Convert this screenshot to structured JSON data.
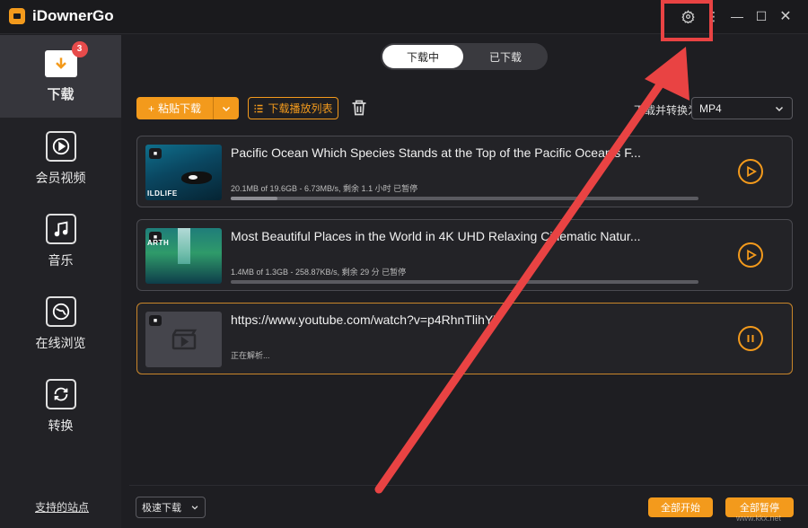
{
  "app": {
    "title": "iDownerGo"
  },
  "titlebar": {
    "settings_icon": "gear-icon",
    "menu_icon": "⋮",
    "minimize_icon": "—",
    "maximize_icon": "☐",
    "close_icon": "✕"
  },
  "sidebar": {
    "items": [
      {
        "label": "下载",
        "icon": "download-icon",
        "badge": "3",
        "active": true
      },
      {
        "label": "会员视频",
        "icon": "play-icon"
      },
      {
        "label": "音乐",
        "icon": "music-icon"
      },
      {
        "label": "在线浏览",
        "icon": "globe-icon"
      },
      {
        "label": "转换",
        "icon": "convert-icon"
      }
    ],
    "supported_sites": "支持的站点"
  },
  "tabs": {
    "downloading": "下载中",
    "downloaded": "已下载"
  },
  "toolbar": {
    "paste_label": "粘贴下载",
    "playlist_label": "下载播放列表",
    "convert_label": "下载并转换为",
    "format_value": "MP4"
  },
  "downloads": [
    {
      "title": "Pacific Ocean Which Species Stands at the Top of the Pacific Ocean's F...",
      "stat": "20.1MB of 19.6GB -   6.73MB/s, 剩余 1.1 小时 已暂停",
      "progress": 0.1,
      "thumb_caption": "ILDLIFE",
      "action": "play"
    },
    {
      "title": "Most Beautiful Places in the World in 4K UHD Relaxing Cinematic Natur...",
      "stat": "1.4MB of 1.3GB -   258.87KB/s, 剩余 29 分 已暂停",
      "progress": 0.0,
      "thumb_caption": "ARTH",
      "action": "play"
    },
    {
      "title": "https://www.youtube.com/watch?v=p4RhnTlihYY",
      "stat": "正在解析...",
      "action": "pause"
    }
  ],
  "footer": {
    "speed_label": "极速下载",
    "start_all": "全部开始",
    "pause_all": "全部暂停"
  },
  "watermark": "www.kkx.net",
  "colors": {
    "accent": "#f39a1c",
    "annotation": "#e94343",
    "background": "#1e1e22"
  }
}
